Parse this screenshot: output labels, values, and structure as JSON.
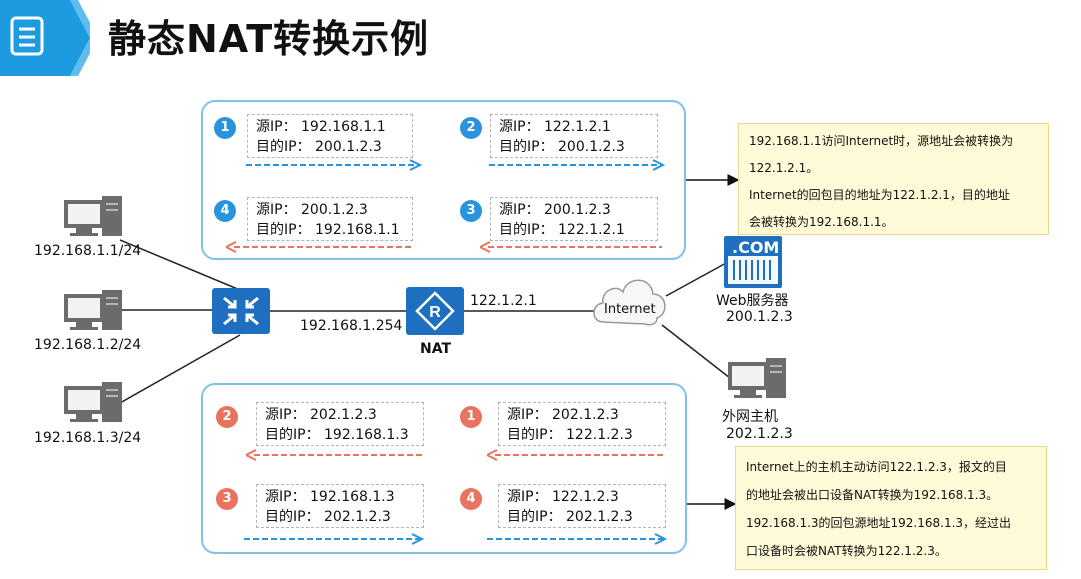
{
  "header": {
    "title": "静态NAT转换示例"
  },
  "hosts": [
    {
      "ip": "192.168.1.1/24"
    },
    {
      "ip": "192.168.1.2/24"
    },
    {
      "ip": "192.168.1.3/24"
    }
  ],
  "switch": {
    "interface_ip": "192.168.1.254"
  },
  "router": {
    "name": "NAT",
    "public_ip": "122.1.2.1"
  },
  "cloud": {
    "label": "Internet"
  },
  "web_server": {
    "badge": ".COM",
    "name": "Web服务器",
    "ip": "200.1.2.3"
  },
  "external_host": {
    "name": "外网主机",
    "ip": "202.1.2.3"
  },
  "top_panel": {
    "packets": [
      {
        "num": "1",
        "src": "源IP：  192.168.1.1",
        "dst": "目的IP：  200.1.2.3"
      },
      {
        "num": "2",
        "src": "源IP：  122.1.2.1",
        "dst": "目的IP：  200.1.2.3"
      },
      {
        "num": "4",
        "src": "源IP：  200.1.2.3",
        "dst": "目的IP：  192.168.1.1"
      },
      {
        "num": "3",
        "src": "源IP：  200.1.2.3",
        "dst": "目的IP：  122.1.2.1"
      }
    ]
  },
  "bottom_panel": {
    "packets": [
      {
        "num": "2",
        "src": "源IP：  202.1.2.3",
        "dst": "目的IP：  192.168.1.3"
      },
      {
        "num": "1",
        "src": "源IP：  202.1.2.3",
        "dst": "目的IP：  122.1.2.3"
      },
      {
        "num": "3",
        "src": "源IP：  192.168.1.3",
        "dst": "目的IP：  202.1.2.3"
      },
      {
        "num": "4",
        "src": "源IP：  122.1.2.3",
        "dst": "目的IP：  202.1.2.3"
      }
    ]
  },
  "note_top": {
    "lines": [
      "192.168.1.1访问Internet时，源地址会被转换为",
      "122.1.2.1。",
      "Internet的回包目的地址为122.1.2.1，目的地址",
      "会被转换为192.168.1.1。"
    ]
  },
  "note_bottom": {
    "lines": [
      "Internet上的主机主动访问122.1.2.3，报文的目",
      "的地址会被出口设备NAT转换为192.168.1.3。",
      "192.168.1.3的回包源地址192.168.1.3，经过出",
      "口设备时会被NAT转换为122.1.2.3。"
    ]
  },
  "colors": {
    "accent_blue": "#2a93dd",
    "accent_red": "#ea7360",
    "device_blue": "#1e6fbf",
    "panel_border": "#7fc2e6",
    "note_bg": "#fffbd9"
  }
}
